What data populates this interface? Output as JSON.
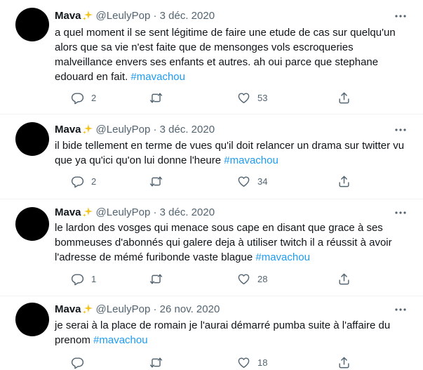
{
  "tweets": [
    {
      "name": "Mava",
      "badge_emoji": "✨",
      "handle": "@LeulyPop",
      "separator": "·",
      "date": "3 déc. 2020",
      "text": "a quel moment il se sent légitime de faire une etude de cas sur quelqu'un alors que sa vie n'est faite que de mensonges vols escroqueries malveillance envers ses enfants et autres. ah oui parce que stephane edouard en fait. ",
      "hashtag": "#mavachou",
      "replies": "2",
      "retweets": "",
      "likes": "53"
    },
    {
      "name": "Mava",
      "badge_emoji": "✨",
      "handle": "@LeulyPop",
      "separator": "·",
      "date": "3 déc. 2020",
      "text": "il bide tellement en terme de vues qu'il doit relancer un drama sur twitter vu que ya qu'ici qu'on lui donne l'heure ",
      "hashtag": "#mavachou",
      "replies": "2",
      "retweets": "",
      "likes": "34"
    },
    {
      "name": "Mava",
      "badge_emoji": "✨",
      "handle": "@LeulyPop",
      "separator": "·",
      "date": "3 déc. 2020",
      "text": "le lardon des vosges qui menace sous cape en disant que grace à ses bommeuses d'abonnés qui galere deja à utiliser twitch il a réussit à avoir l'adresse de mémé furibonde vaste blague ",
      "hashtag": "#mavachou",
      "replies": "1",
      "retweets": "",
      "likes": "28"
    },
    {
      "name": "Mava",
      "badge_emoji": "✨",
      "handle": "@LeulyPop",
      "separator": "·",
      "date": "26 nov. 2020",
      "text": "je serai à la place de romain je l'aurai démarré pumba suite à l'affaire du prenom ",
      "hashtag": "#mavachou",
      "replies": "",
      "retweets": "",
      "likes": "18"
    }
  ],
  "icons": {
    "avatar": "avatar-black-circle",
    "badge": "sparkles-icon",
    "more": "more-icon",
    "reply": "reply-icon",
    "retweet": "retweet-icon",
    "like": "like-icon",
    "share": "share-icon"
  },
  "colors": {
    "text": "#0f1419",
    "muted": "#536471",
    "hashtag": "#1d9bf0",
    "divider": "#eff3f4",
    "sparkle": "#f7c21a"
  }
}
